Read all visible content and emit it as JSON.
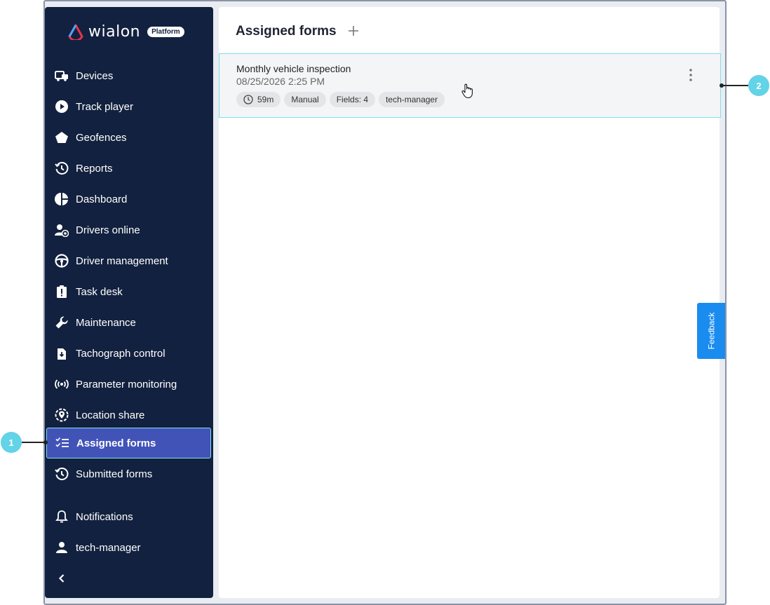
{
  "brand": {
    "name": "wialon",
    "badge": "Platform"
  },
  "sidebar": {
    "items": [
      {
        "label": "Devices",
        "icon": "vehicle-icon"
      },
      {
        "label": "Track player",
        "icon": "play-icon"
      },
      {
        "label": "Geofences",
        "icon": "pentagon-icon"
      },
      {
        "label": "Reports",
        "icon": "history-icon"
      },
      {
        "label": "Dashboard",
        "icon": "pie-chart-icon"
      },
      {
        "label": "Drivers online",
        "icon": "driver-online-icon"
      },
      {
        "label": "Driver management",
        "icon": "steering-wheel-icon"
      },
      {
        "label": "Task desk",
        "icon": "clipboard-alert-icon"
      },
      {
        "label": "Maintenance",
        "icon": "wrench-icon"
      },
      {
        "label": "Tachograph control",
        "icon": "tachograph-icon"
      },
      {
        "label": "Parameter monitoring",
        "icon": "broadcast-icon"
      },
      {
        "label": "Location share",
        "icon": "location-share-icon"
      },
      {
        "label": "Assigned forms",
        "icon": "checklist-icon",
        "active": true
      },
      {
        "label": "Submitted forms",
        "icon": "history-icon"
      }
    ],
    "bottom": [
      {
        "label": "Notifications",
        "icon": "bell-icon"
      },
      {
        "label": "tech-manager",
        "icon": "user-icon"
      }
    ],
    "collapse_icon": "chevron-left-icon"
  },
  "main": {
    "title": "Assigned forms",
    "card": {
      "title": "Monthly vehicle inspection",
      "date": "08/25/2026 2:25 PM",
      "chips": [
        "59m",
        "Manual",
        "Fields: 4",
        "tech-manager"
      ]
    }
  },
  "feedback": {
    "label": "Feedback"
  },
  "callouts": [
    "1",
    "2"
  ],
  "colors": {
    "sidebar_bg": "#12213f",
    "active_bg": "#4253b8",
    "highlight": "#7fe0ea",
    "callout": "#63d3e8",
    "feedback": "#1a8cf0"
  }
}
